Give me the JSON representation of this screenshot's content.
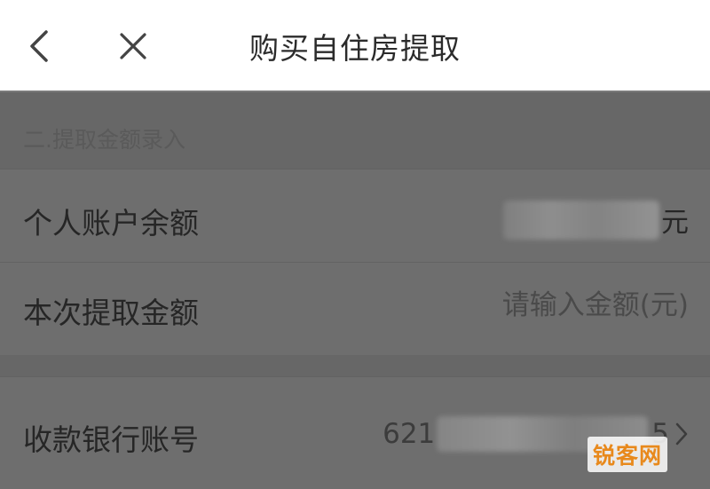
{
  "header": {
    "title": "购买自住房提取",
    "back_icon": "chevron-left-icon",
    "close_icon": "close-icon"
  },
  "section": {
    "title": "二.提取金额录入"
  },
  "rows": {
    "balance": {
      "label": "个人账户余额",
      "unit": "元"
    },
    "amount": {
      "label": "本次提取金额",
      "placeholder": "请输入金额(元)"
    },
    "bank_account": {
      "label": "收款银行账号",
      "prefix": "621",
      "suffix": "5",
      "chevron_icon": "chevron-right-icon"
    }
  },
  "watermark": {
    "text": "锐客网",
    "color": "#e8891c"
  },
  "colors": {
    "header_bg": "#ffffff",
    "overlay": "#6e6e6e"
  }
}
